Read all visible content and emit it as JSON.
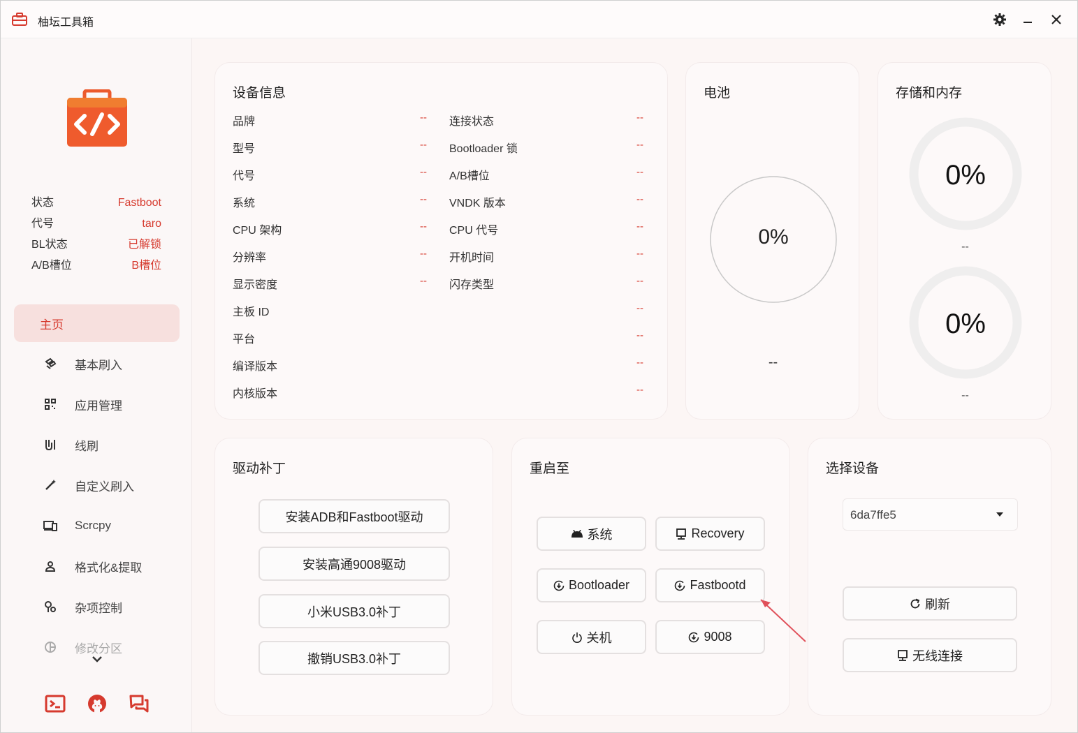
{
  "window": {
    "title": "柚坛工具箱"
  },
  "sidebar": {
    "status": [
      {
        "key": "状态",
        "value": "Fastboot"
      },
      {
        "key": "代号",
        "value": "taro"
      },
      {
        "key": "BL状态",
        "value": "已解锁"
      },
      {
        "key": "A/B槽位",
        "value": "B槽位"
      }
    ],
    "nav": [
      {
        "label": "主页",
        "icon": "home"
      },
      {
        "label": "基本刷入",
        "icon": "flash-icon"
      },
      {
        "label": "应用管理",
        "icon": "apps-grid-icon"
      },
      {
        "label": "线刷",
        "icon": "cable-icon"
      },
      {
        "label": "自定义刷入",
        "icon": "magic-wand-icon"
      },
      {
        "label": "Scrcpy",
        "icon": "devices-icon"
      },
      {
        "label": "格式化&提取",
        "icon": "user-badge-icon"
      },
      {
        "label": "杂项控制",
        "icon": "settings-tools-icon"
      },
      {
        "label": "修改分区",
        "icon": "pie-icon"
      }
    ]
  },
  "device_info": {
    "title": "设备信息",
    "left": [
      {
        "label": "品牌",
        "value": "--"
      },
      {
        "label": "型号",
        "value": "--"
      },
      {
        "label": "代号",
        "value": "--"
      },
      {
        "label": "系统",
        "value": "--"
      },
      {
        "label": "CPU 架构",
        "value": "--"
      },
      {
        "label": "分辨率",
        "value": "--"
      },
      {
        "label": "显示密度",
        "value": "--"
      },
      {
        "label": "主板 ID",
        "value": "--"
      },
      {
        "label": "平台",
        "value": "--"
      },
      {
        "label": "编译版本",
        "value": "--"
      },
      {
        "label": "内核版本",
        "value": "--"
      }
    ],
    "right": [
      {
        "label": "连接状态",
        "value": "--"
      },
      {
        "label": "Bootloader 锁",
        "value": "--"
      },
      {
        "label": "A/B槽位",
        "value": "--"
      },
      {
        "label": "VNDK 版本",
        "value": "--"
      },
      {
        "label": "CPU 代号",
        "value": "--"
      },
      {
        "label": "开机时间",
        "value": "--"
      },
      {
        "label": "闪存类型",
        "value": "--"
      }
    ]
  },
  "battery": {
    "title": "电池",
    "percent": "0%",
    "detail": "--"
  },
  "storage": {
    "title": "存储和内存",
    "storage_percent": "0%",
    "storage_detail": "--",
    "memory_percent": "0%",
    "memory_detail": "--"
  },
  "driver": {
    "title": "驱动补丁",
    "buttons": [
      "安装ADB和Fastboot驱动",
      "安装高通9008驱动",
      "小米USB3.0补丁",
      "撤销USB3.0补丁"
    ]
  },
  "reboot": {
    "title": "重启至",
    "buttons": [
      "系统",
      "Recovery",
      "Bootloader",
      "Fastbootd",
      "关机",
      "9008"
    ]
  },
  "select_device": {
    "title": "选择设备",
    "selected": "6da7ffe5",
    "refresh": "刷新",
    "wireless": "无线连接"
  },
  "colors": {
    "accent": "#d63a2e",
    "active_bg": "#f7e0de",
    "annotation_arrow": "#e0505a"
  }
}
